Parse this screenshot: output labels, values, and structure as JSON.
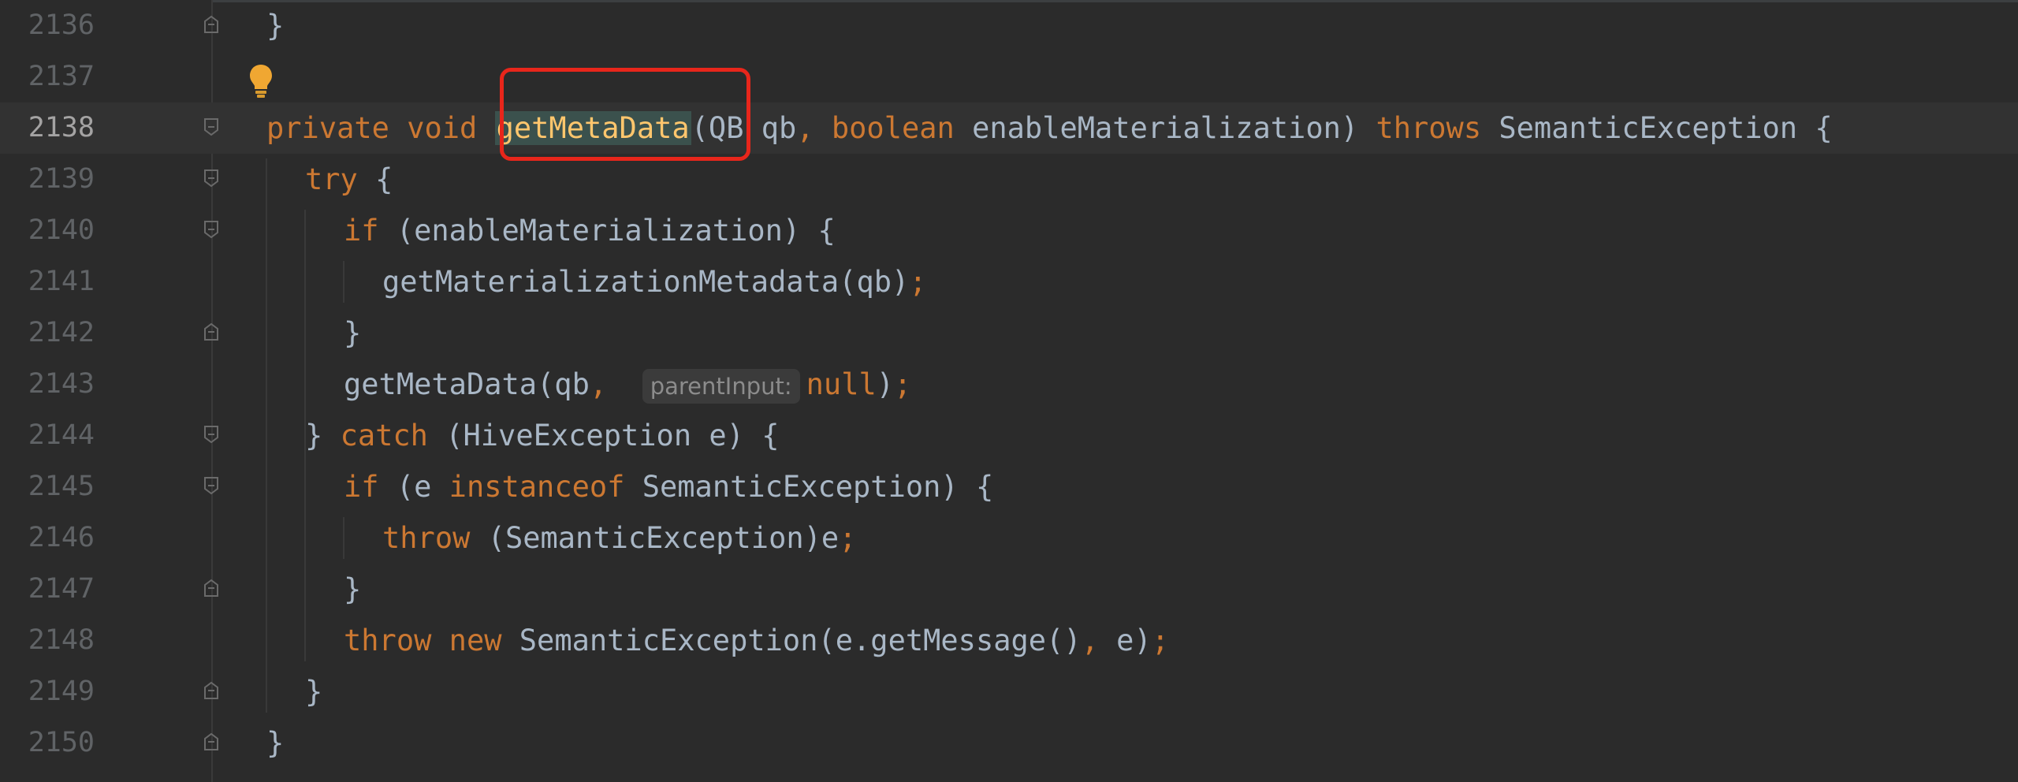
{
  "editor": {
    "lines": [
      {
        "num": "2136",
        "tokens": [
          {
            "t": "}",
            "c": ""
          }
        ]
      },
      {
        "num": "2137",
        "tokens": []
      },
      {
        "num": "2138",
        "tokens": [
          {
            "t": "private",
            "c": "kw"
          },
          {
            "t": " ",
            "c": ""
          },
          {
            "t": "void",
            "c": "kw"
          },
          {
            "t": " ",
            "c": ""
          },
          {
            "t": "getMetaData",
            "c": "fn-decl"
          },
          {
            "t": "(QB qb",
            "c": ""
          },
          {
            "t": ",",
            "c": "punct"
          },
          {
            "t": " ",
            "c": ""
          },
          {
            "t": "boolean",
            "c": "kw"
          },
          {
            "t": " enableMaterialization) ",
            "c": ""
          },
          {
            "t": "throws",
            "c": "kw"
          },
          {
            "t": " SemanticException {",
            "c": ""
          }
        ]
      },
      {
        "num": "2139",
        "tokens": [
          {
            "t": "try",
            "c": "kw"
          },
          {
            "t": " {",
            "c": ""
          }
        ]
      },
      {
        "num": "2140",
        "tokens": [
          {
            "t": "if",
            "c": "kw"
          },
          {
            "t": " (enableMaterialization) {",
            "c": ""
          }
        ]
      },
      {
        "num": "2141",
        "tokens": [
          {
            "t": "getMaterializationMetadata(qb)",
            "c": ""
          },
          {
            "t": ";",
            "c": "punct"
          }
        ]
      },
      {
        "num": "2142",
        "tokens": [
          {
            "t": "}",
            "c": ""
          }
        ]
      },
      {
        "num": "2143",
        "tokens": [
          {
            "t": "getMetaData(qb",
            "c": ""
          },
          {
            "t": ",",
            "c": "punct"
          },
          {
            "t": "  ",
            "c": ""
          },
          {
            "t": "parentInput:",
            "c": "hint"
          },
          {
            "t": "null",
            "c": "kw"
          },
          {
            "t": ")",
            "c": ""
          },
          {
            "t": ";",
            "c": "punct"
          }
        ]
      },
      {
        "num": "2144",
        "tokens": [
          {
            "t": "} ",
            "c": ""
          },
          {
            "t": "catch",
            "c": "kw"
          },
          {
            "t": " (HiveException e) {",
            "c": ""
          }
        ]
      },
      {
        "num": "2145",
        "tokens": [
          {
            "t": "if",
            "c": "kw"
          },
          {
            "t": " (e ",
            "c": ""
          },
          {
            "t": "instanceof",
            "c": "kw"
          },
          {
            "t": " SemanticException) {",
            "c": ""
          }
        ]
      },
      {
        "num": "2146",
        "tokens": [
          {
            "t": "throw",
            "c": "kw"
          },
          {
            "t": " (SemanticException)e",
            "c": ""
          },
          {
            "t": ";",
            "c": "punct"
          }
        ]
      },
      {
        "num": "2147",
        "tokens": [
          {
            "t": "}",
            "c": ""
          }
        ]
      },
      {
        "num": "2148",
        "tokens": [
          {
            "t": "throw",
            "c": "kw"
          },
          {
            "t": " ",
            "c": ""
          },
          {
            "t": "new",
            "c": "kw"
          },
          {
            "t": " SemanticException(e.getMessage()",
            "c": ""
          },
          {
            "t": ",",
            "c": "punct"
          },
          {
            "t": " e)",
            "c": ""
          },
          {
            "t": ";",
            "c": "punct"
          }
        ]
      },
      {
        "num": "2149",
        "tokens": [
          {
            "t": "}",
            "c": ""
          }
        ]
      },
      {
        "num": "2150",
        "tokens": [
          {
            "t": "}",
            "c": ""
          }
        ]
      }
    ],
    "current_line": "2138",
    "icons": {
      "intention": "lightbulb-icon",
      "fold": "fold-marker-icon"
    },
    "colors": {
      "background": "#2b2b2b",
      "keyword": "#cc7832",
      "function_declaration": "#ffc66d",
      "text": "#a9b7c6",
      "line_number": "#606366",
      "annotation_box": "#e8261b"
    }
  }
}
